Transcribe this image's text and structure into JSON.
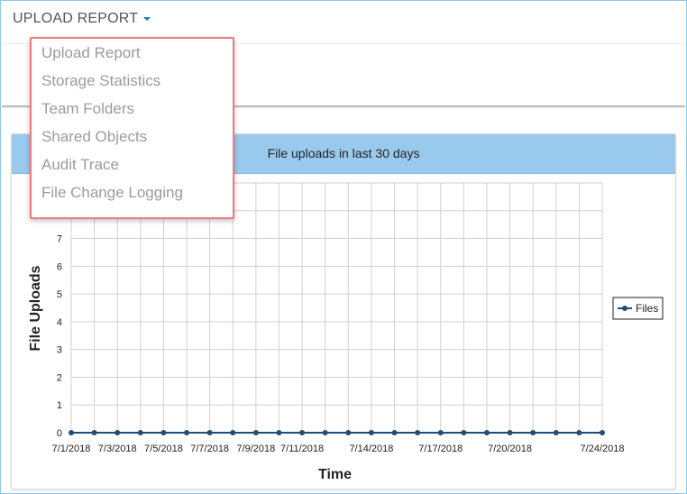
{
  "header": {
    "title": "UPLOAD REPORT"
  },
  "menu": {
    "items": [
      "Upload Report",
      "Storage Statistics",
      "Team Folders",
      "Shared Objects",
      "Audit Trace",
      "File Change Logging"
    ]
  },
  "panel": {
    "heading": "File uploads in last 30 days"
  },
  "colors": {
    "accent": "#1a78c2",
    "panel_heading": "#9ac9ee",
    "series": "#1f4e79",
    "menu_border": "#ee7b7b"
  },
  "chart_data": {
    "type": "line",
    "xlabel": "Time",
    "ylabel": "File Uploads",
    "ylim": [
      0,
      9
    ],
    "yticks": [
      0,
      1,
      2,
      3,
      4,
      5,
      6,
      7,
      8
    ],
    "legend_position": "right",
    "grid": true,
    "x_tick_labels": [
      "7/1/2018",
      "7/3/2018",
      "7/5/2018",
      "7/7/2018",
      "7/9/2018",
      "7/11/2018",
      "7/14/2018",
      "7/17/2018",
      "7/20/2018",
      "7/24/2018"
    ],
    "series": [
      {
        "name": "Files",
        "x": [
          "7/1/2018",
          "7/2/2018",
          "7/3/2018",
          "7/4/2018",
          "7/5/2018",
          "7/6/2018",
          "7/7/2018",
          "7/8/2018",
          "7/9/2018",
          "7/10/2018",
          "7/11/2018",
          "7/12/2018",
          "7/13/2018",
          "7/14/2018",
          "7/15/2018",
          "7/16/2018",
          "7/17/2018",
          "7/18/2018",
          "7/19/2018",
          "7/20/2018",
          "7/21/2018",
          "7/22/2018",
          "7/23/2018",
          "7/24/2018"
        ],
        "values": [
          0,
          0,
          0,
          0,
          0,
          0,
          0,
          0,
          0,
          0,
          0,
          0,
          0,
          0,
          0,
          0,
          0,
          0,
          0,
          0,
          0,
          0,
          0,
          0
        ]
      }
    ]
  }
}
